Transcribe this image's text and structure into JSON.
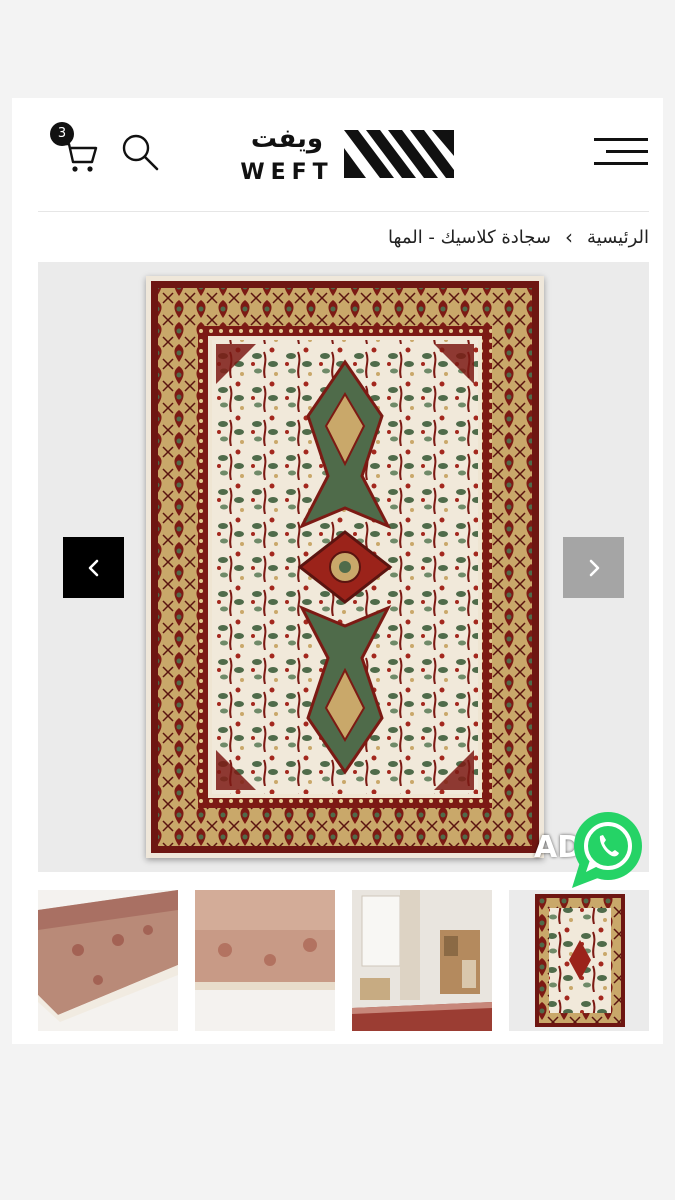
{
  "header": {
    "cart_count": "3",
    "logo_ar": "ويفت",
    "logo_en": "WEFT"
  },
  "breadcrumb": {
    "home": "الرئيسية",
    "separator": "›",
    "current": "سجادة كلاسيك - المها"
  },
  "gallery": {
    "prev_icon": "chevron-left-icon",
    "next_icon": "chevron-right-icon",
    "thumbnails": [
      "rug-edge-closeup",
      "rug-pile-closeup",
      "room-scene",
      "rug-full-view"
    ]
  },
  "overlay": {
    "ad_label": "AD",
    "whatsapp_icon": "whatsapp-icon"
  },
  "colors": {
    "rug_red": "#7c1a14",
    "rug_gold": "#c9a86a",
    "rug_cream": "#f1e9da",
    "rug_green": "#4f6b4a",
    "whatsapp_green": "#25d366"
  }
}
